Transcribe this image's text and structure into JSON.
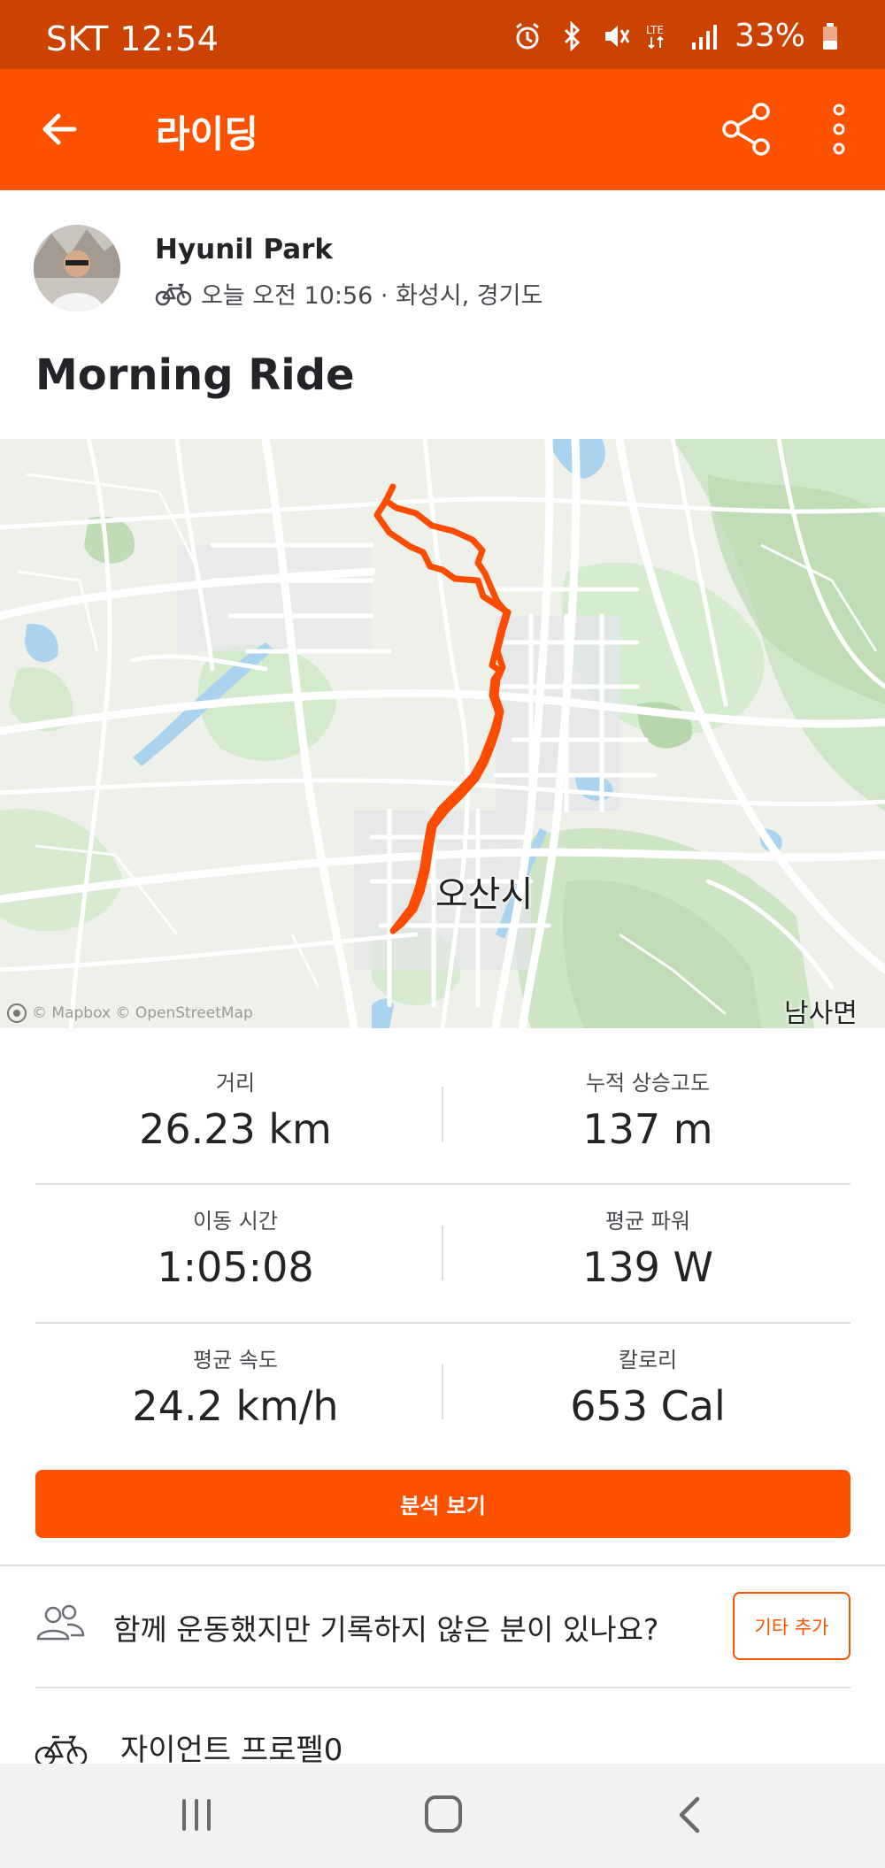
{
  "status_bar": {
    "carrier_time": "SKT 12:54",
    "battery": "33%"
  },
  "app_bar": {
    "title": "라이딩"
  },
  "athlete": {
    "name": "Hyunil Park",
    "meta": "오늘 오전 10:56 · 화성시, 경기도"
  },
  "activity": {
    "title": "Morning Ride"
  },
  "map": {
    "city_label": "오산시",
    "district_label": "남사면",
    "attribution": "© Mapbox © OpenStreetMap",
    "route_color": "#fc4c02"
  },
  "stats": [
    {
      "label": "거리",
      "value": "26.23 km"
    },
    {
      "label": "누적 상승고도",
      "value": "137 m"
    },
    {
      "label": "이동 시간",
      "value": "1:05:08"
    },
    {
      "label": "평균 파워",
      "value": "139 W"
    },
    {
      "label": "평균 속도",
      "value": "24.2 km/h"
    },
    {
      "label": "칼로리",
      "value": "653 Cal"
    }
  ],
  "analysis_button": "분석 보기",
  "group_prompt": {
    "text": "함께 운동했지만 기록하지 않은 분이 있나요?",
    "button": "기타 추가"
  },
  "gear": {
    "name": "자이언트  프로펠0"
  },
  "colors": {
    "brand": "#fc5200",
    "status_bar": "#cc4200"
  },
  "icons": {
    "back": "arrow-left-icon",
    "share": "share-icon",
    "more": "more-vertical-icon",
    "bike": "bike-icon",
    "group": "group-icon"
  }
}
